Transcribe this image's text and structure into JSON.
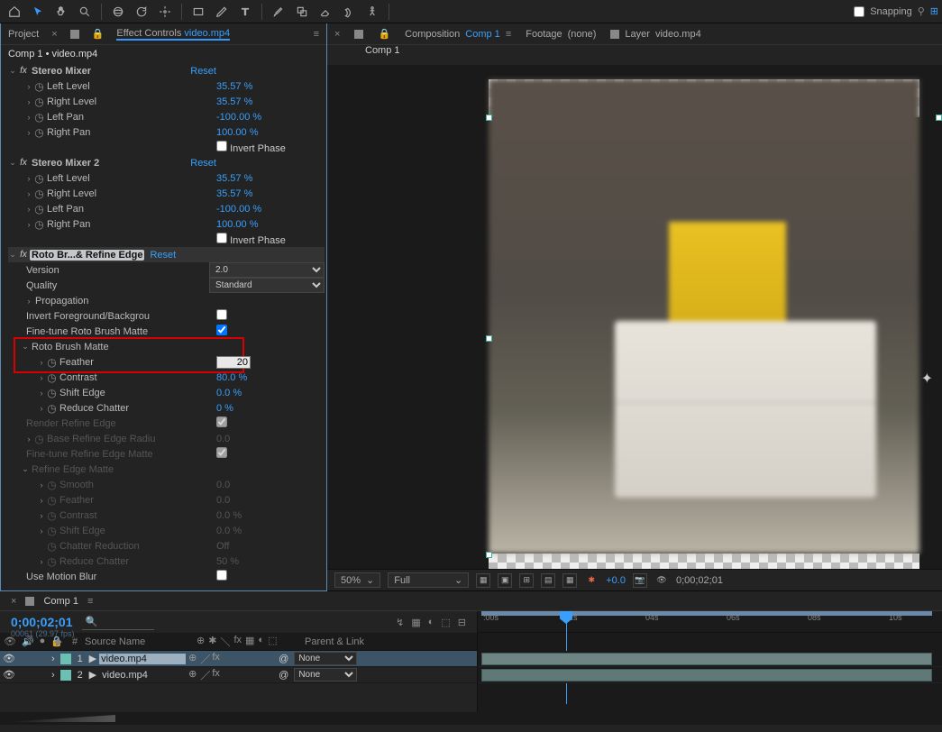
{
  "toolbar": {
    "snapping_label": "Snapping"
  },
  "panel": {
    "project_tab": "Project",
    "effect_controls_tab": "Effect Controls",
    "current_file": "video.mp4",
    "subtitle": "Comp 1 • video.mp4"
  },
  "effects": {
    "stereo1": {
      "name": "Stereo Mixer",
      "reset": "Reset",
      "left_level": {
        "label": "Left Level",
        "value": "35.57 %"
      },
      "right_level": {
        "label": "Right Level",
        "value": "35.57 %"
      },
      "left_pan": {
        "label": "Left Pan",
        "value": "-100.00 %"
      },
      "right_pan": {
        "label": "Right Pan",
        "value": "100.00 %"
      },
      "invert_phase": "Invert Phase"
    },
    "stereo2": {
      "name": "Stereo Mixer 2",
      "reset": "Reset",
      "left_level": {
        "label": "Left Level",
        "value": "35.57 %"
      },
      "right_level": {
        "label": "Right Level",
        "value": "35.57 %"
      },
      "left_pan": {
        "label": "Left Pan",
        "value": "-100.00 %"
      },
      "right_pan": {
        "label": "Right Pan",
        "value": "100.00 %"
      },
      "invert_phase": "Invert Phase"
    },
    "roto": {
      "name": "Roto Br...& Refine Edge",
      "reset": "Reset",
      "version": {
        "label": "Version",
        "value": "2.0"
      },
      "quality": {
        "label": "Quality",
        "value": "Standard"
      },
      "propagation": "Propagation",
      "invert_fb": "Invert Foreground/Backgrou",
      "finetune_rb": "Fine-tune Roto Brush Matte",
      "rbmatte": {
        "label": "Roto Brush Matte",
        "feather": {
          "label": "Feather",
          "value": "20"
        },
        "contrast": {
          "label": "Contrast",
          "value": "80.0 %"
        },
        "shift_edge": {
          "label": "Shift Edge",
          "value": "0.0 %"
        },
        "reduce_chatter": {
          "label": "Reduce Chatter",
          "value": "0 %"
        }
      },
      "render_refine": "Render Refine Edge",
      "base_radius": {
        "label": "Base Refine Edge Radiu",
        "value": "0.0"
      },
      "finetune_re": "Fine-tune Refine Edge Matte",
      "rematte": {
        "label": "Refine Edge Matte",
        "smooth": {
          "label": "Smooth",
          "value": "0.0"
        },
        "feather": {
          "label": "Feather",
          "value": "0.0"
        },
        "contrast": {
          "label": "Contrast",
          "value": "0.0 %"
        },
        "shift_edge": {
          "label": "Shift Edge",
          "value": "0.0 %"
        },
        "chatter_red": {
          "label": "Chatter Reduction",
          "value": "Off"
        },
        "reduce_chatter": {
          "label": "Reduce Chatter",
          "value": "50 %"
        }
      },
      "motion_blur": "Use Motion Blur"
    }
  },
  "composition": {
    "label": "Composition",
    "name": "Comp 1",
    "footage_label": "Footage",
    "footage_val": "(none)",
    "layer_label": "Layer",
    "layer_val": "video.mp4",
    "tab": "Comp 1"
  },
  "viewerbar": {
    "zoom": "50%",
    "res": "Full",
    "exposure": "+0.0",
    "timecode": "0;00;02;01"
  },
  "timeline": {
    "tab": "Comp 1",
    "timecode": "0;00;02;01",
    "frames": "00061 (29.97 fps)",
    "cols": {
      "num": "#",
      "src": "Source Name",
      "parent": "Parent & Link"
    },
    "layers": [
      {
        "num": "1",
        "name": "video.mp4",
        "parent": "None",
        "selected": true
      },
      {
        "num": "2",
        "name": "video.mp4",
        "parent": "None",
        "selected": false
      }
    ],
    "ticks": [
      ":00s",
      "02s",
      "04s",
      "06s",
      "08s",
      "10s"
    ],
    "none_label": "None"
  }
}
